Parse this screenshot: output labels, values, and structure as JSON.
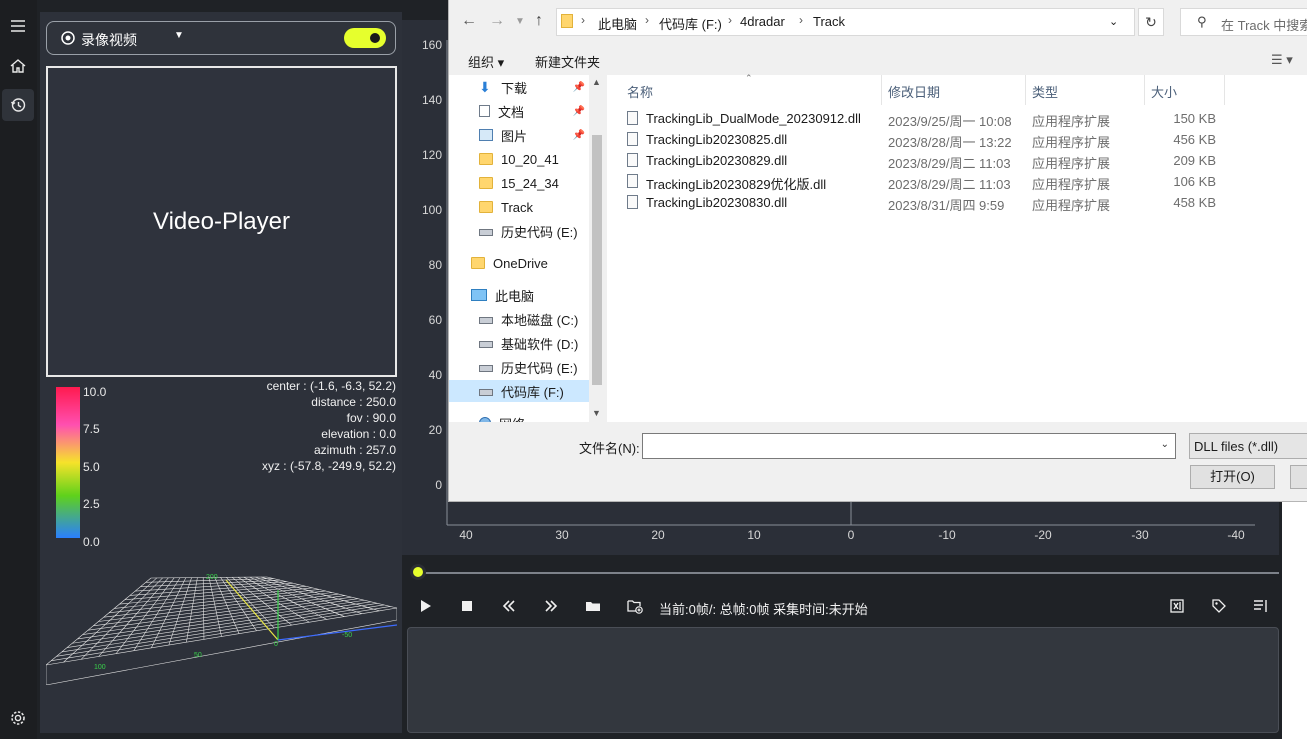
{
  "app": {
    "source_select_label": "录像视频",
    "video_player_label": "Video-Player",
    "colorbar_ticks": [
      "10.0",
      "7.5",
      "5.0",
      "2.5",
      "0.0"
    ],
    "camera_info": [
      "center : (-1.6, -6.3, 52.2)",
      "distance : 250.0",
      "fov : 90.0",
      "elevation : 0.0",
      "azimuth : 257.0",
      "xyz : (-57.8, -249.9, 52.2)"
    ],
    "grid_labels": [
      "200",
      "100",
      "50",
      "0",
      "-50"
    ],
    "chart": {
      "y_ticks": [
        "160",
        "140",
        "120",
        "100",
        "80",
        "60",
        "40",
        "20",
        "0"
      ],
      "x_ticks": [
        "40",
        "30",
        "20",
        "10",
        "0",
        "-10",
        "-20",
        "-30",
        "-40"
      ]
    },
    "playback_status": "当前:0帧/: 总帧:0帧 采集时间:未开始",
    "slider_progress": 0,
    "accent_color": "#e6ff2d"
  },
  "dialog": {
    "breadcrumbs": [
      "此电脑",
      "代码库 (F:)",
      "4dradar",
      "Track"
    ],
    "search_placeholder": "在 Track 中搜索",
    "toolbar": {
      "organize": "组织",
      "new_folder": "新建文件夹"
    },
    "tree": [
      {
        "label": "下载",
        "icon": "download-icon",
        "pinned": true
      },
      {
        "label": "文档",
        "icon": "document-icon",
        "pinned": true
      },
      {
        "label": "图片",
        "icon": "picture-icon",
        "pinned": true
      },
      {
        "label": "10_20_41",
        "icon": "folder-icon"
      },
      {
        "label": "15_24_34",
        "icon": "folder-icon"
      },
      {
        "label": "Track",
        "icon": "folder-icon"
      },
      {
        "label": "历史代码 (E:)",
        "icon": "drive-icon"
      },
      {
        "label": "OneDrive",
        "icon": "folder-icon"
      },
      {
        "label": "此电脑",
        "icon": "computer-icon"
      },
      {
        "label": "本地磁盘 (C:)",
        "icon": "drive-icon"
      },
      {
        "label": "基础软件 (D:)",
        "icon": "drive-icon"
      },
      {
        "label": "历史代码 (E:)",
        "icon": "drive-icon"
      },
      {
        "label": "代码库 (F:)",
        "icon": "drive-icon",
        "selected": true
      },
      {
        "label": "网络",
        "icon": "network-icon"
      }
    ],
    "columns": [
      "名称",
      "修改日期",
      "类型",
      "大小"
    ],
    "files": [
      {
        "name": "TrackingLib_DualMode_20230912.dll",
        "date": "2023/9/25/周一 10:08",
        "type": "应用程序扩展",
        "size": "150 KB"
      },
      {
        "name": "TrackingLib20230825.dll",
        "date": "2023/8/28/周一 13:22",
        "type": "应用程序扩展",
        "size": "456 KB"
      },
      {
        "name": "TrackingLib20230829.dll",
        "date": "2023/8/29/周二 11:03",
        "type": "应用程序扩展",
        "size": "209 KB"
      },
      {
        "name": "TrackingLib20230829优化版.dll",
        "date": "2023/8/29/周二 11:03",
        "type": "应用程序扩展",
        "size": "106 KB"
      },
      {
        "name": "TrackingLib20230830.dll",
        "date": "2023/8/31/周四 9:59",
        "type": "应用程序扩展",
        "size": "458 KB"
      }
    ],
    "filename_label": "文件名(N):",
    "filename_value": "",
    "filetype": "DLL files (*.dll)",
    "open_button": "打开(O)"
  }
}
